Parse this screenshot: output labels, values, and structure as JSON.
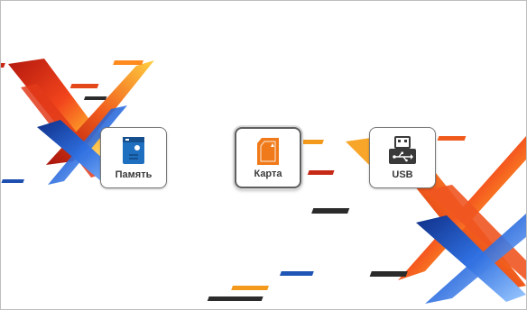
{
  "sources": [
    {
      "id": "memory",
      "label": "Память",
      "icon": "binder-icon",
      "selected": false
    },
    {
      "id": "card",
      "label": "Карта",
      "icon": "sd-card-icon",
      "selected": true
    },
    {
      "id": "usb",
      "label": "USB",
      "icon": "usb-icon",
      "selected": false
    }
  ],
  "colors": {
    "background": "#ffffff",
    "memory_icon": "#1f6fc0",
    "card_icon": "#f07a1a",
    "usb_icon": "#3a3a3a",
    "deco_red": "#c62a16",
    "deco_orange": "#f39a1c",
    "deco_blue": "#1f56b5"
  }
}
